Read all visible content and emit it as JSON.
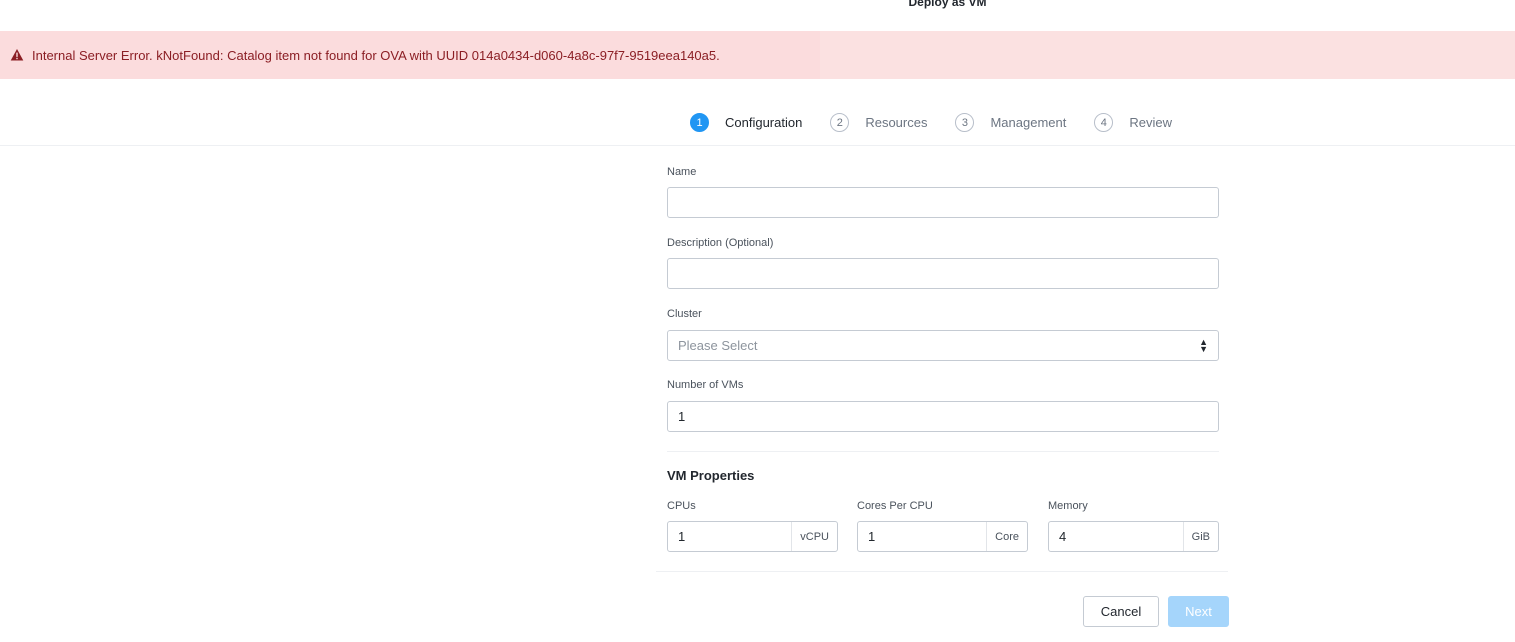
{
  "modal": {
    "title": "Deploy as VM"
  },
  "error": {
    "message": "Internal Server Error. kNotFound: Catalog item not found for OVA with UUID 014a0434-d060-4a8c-97f7-9519eea140a5.",
    "icon": "warning-triangle-icon",
    "background": "#fbdcdd",
    "text_color": "#8b1e24"
  },
  "steps": [
    {
      "number": "1",
      "label": "Configuration",
      "active": true
    },
    {
      "number": "2",
      "label": "Resources",
      "active": false
    },
    {
      "number": "3",
      "label": "Management",
      "active": false
    },
    {
      "number": "4",
      "label": "Review",
      "active": false
    }
  ],
  "form": {
    "name": {
      "label": "Name",
      "value": ""
    },
    "description": {
      "label": "Description (Optional)",
      "value": ""
    },
    "cluster": {
      "label": "Cluster",
      "placeholder": "Please Select"
    },
    "num_vms": {
      "label": "Number of VMs",
      "value": "1"
    }
  },
  "vm_properties": {
    "title": "VM Properties",
    "cpus": {
      "label": "CPUs",
      "value": "1",
      "unit": "vCPU"
    },
    "cores": {
      "label": "Cores Per CPU",
      "value": "1",
      "unit": "Core"
    },
    "memory": {
      "label": "Memory",
      "value": "4",
      "unit": "GiB"
    }
  },
  "footer": {
    "cancel_label": "Cancel",
    "next_label": "Next"
  },
  "colors": {
    "accent": "#2196f3",
    "next_disabled": "#a5d5fb"
  }
}
